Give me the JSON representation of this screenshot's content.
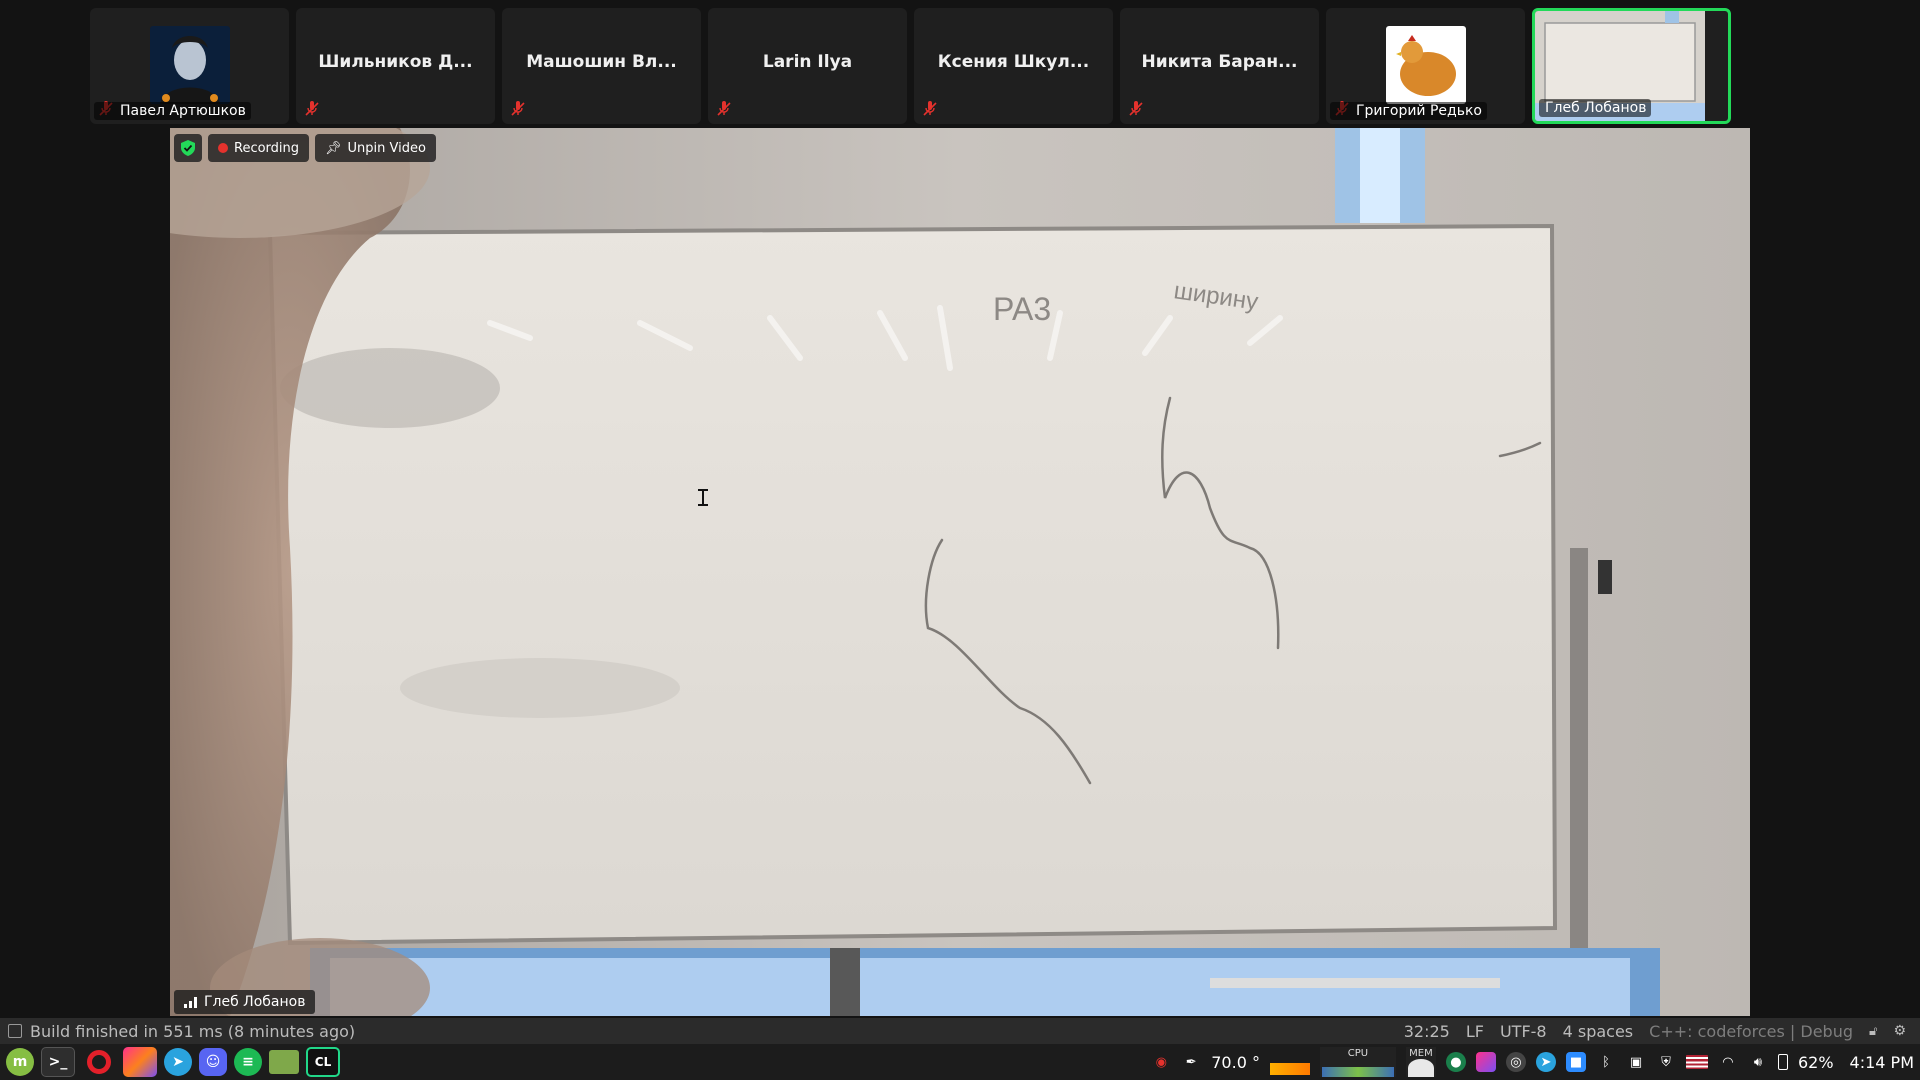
{
  "participants": [
    {
      "name": "Павел Артюшков",
      "muted": true,
      "has_avatar": true,
      "avatar": "man-portrait"
    },
    {
      "name": "Шильников Д...",
      "muted": true,
      "has_avatar": false
    },
    {
      "name": "Машошин Вл...",
      "muted": true,
      "has_avatar": false
    },
    {
      "name": "Larin Ilya",
      "muted": true,
      "has_avatar": false
    },
    {
      "name": "Ксения Шкул...",
      "muted": true,
      "has_avatar": false
    },
    {
      "name": "Никита Баран...",
      "muted": true,
      "has_avatar": false
    },
    {
      "name": "Григорий Редько",
      "muted": true,
      "has_avatar": true,
      "avatar": "hen-photo"
    },
    {
      "name": "Глеб Лобанов",
      "muted": false,
      "has_avatar": true,
      "avatar": "whiteboard-thumb",
      "active": true
    }
  ],
  "video": {
    "recording_label": "Recording",
    "unpin_label": "Unpin Video",
    "speaker_name": "Глеб Лобанов",
    "board_text_1": "PA3",
    "board_text_2": "ширину"
  },
  "statusbar": {
    "build_message": "Build finished in 551 ms (8 minutes ago)",
    "position": "32:25",
    "line_ending": "LF",
    "encoding": "UTF-8",
    "indent": "4 spaces",
    "context": "C++: codeforces | Debug"
  },
  "taskbar": {
    "apps": [
      "mint-menu-icon",
      "terminal-icon",
      "opera-icon",
      "jetbrains-toolbox-icon",
      "telegram-icon",
      "discord-icon",
      "spotify-icon",
      "files-icon",
      "clion-icon"
    ],
    "temperature": "70.0 °",
    "cpu_label": "CPU",
    "mem_label": "MEM",
    "battery": "62%",
    "time": "4:14 PM"
  },
  "colors": {
    "active_border": "#23d959",
    "mute_red": "#e5322d",
    "statusbar_bg": "#2b2b2b"
  }
}
